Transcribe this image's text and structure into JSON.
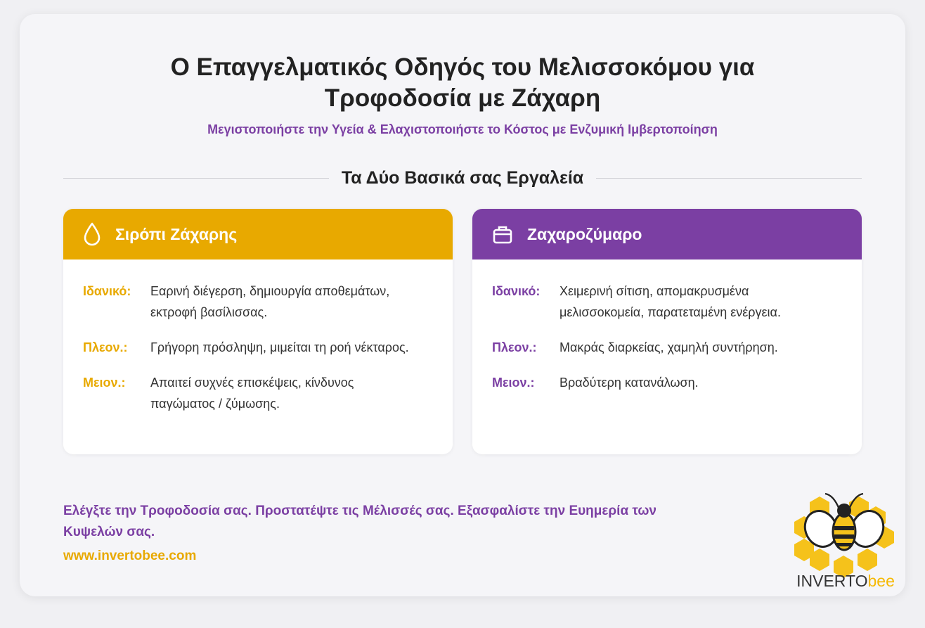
{
  "header": {
    "title_line1": "Ο Επαγγελματικός Οδηγός του Μελισσοκόμου για",
    "title_line2": "Τροφοδοσία με Ζάχαρη",
    "subtitle": "Μεγιστοποιήστε την Υγεία & Ελαχιστοποιήστε το Κόστος με Ενζυμική Ιμβερτοποίηση"
  },
  "section_title": "Τα Δύο Βασικά σας Εργαλεία",
  "colors": {
    "gold": "#e8a900",
    "purple": "#7b3fa3"
  },
  "panels": [
    {
      "title": "Σιρόπι Ζάχαρης",
      "icon": "drop-icon",
      "rows": [
        {
          "key": "Ιδανικό:",
          "value": "Εαρινή διέγερση, δημιουργία αποθεμάτων, εκτροφή βασίλισσας."
        },
        {
          "key": "Πλεον.:",
          "value": "Γρήγορη πρόσληψη, μιμείται τη ροή νέκταρος."
        },
        {
          "key": "Μειον.:",
          "value": "Απαιτεί συχνές επισκέψεις, κίνδυνος παγώματος / ζύμωσης."
        }
      ]
    },
    {
      "title": "Ζαχαροζύμαρο",
      "icon": "box-icon",
      "rows": [
        {
          "key": "Ιδανικό:",
          "value": "Χειμερινή σίτιση, απομακρυσμένα μελισσοκομεία, παρατεταμένη ενέργεια."
        },
        {
          "key": "Πλεον.:",
          "value": "Μακράς διαρκείας, χαμηλή συντήρηση."
        },
        {
          "key": "Μειον.:",
          "value": "Βραδύτερη κατανάλωση."
        }
      ]
    }
  ],
  "footer": {
    "tagline": "Ελέγξτε την Τροφοδοσία σας. Προστατέψτε τις Μέλισσές σας. Εξασφαλίστε την Ευημερία των Κυψελών σας.",
    "website": "www.invertobee.com",
    "logo_part1": "INVERTO",
    "logo_part2": "bee"
  }
}
